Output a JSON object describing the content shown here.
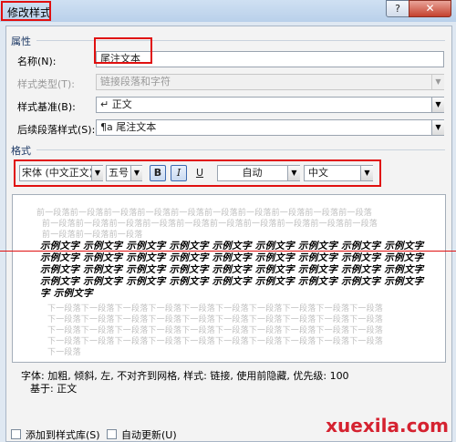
{
  "window": {
    "title": "修改样式",
    "help": "?",
    "close": "✕"
  },
  "properties": {
    "section": "属性",
    "name_label": "名称(N):",
    "name_value": "尾注文本",
    "type_label": "样式类型(T):",
    "type_value": "链接段落和字符",
    "based_label": "样式基准(B):",
    "based_icon": "↵",
    "based_value": "正文",
    "next_label": "后续段落样式(S):",
    "next_icon": "¶a",
    "next_value": "尾注文本"
  },
  "format": {
    "section": "格式",
    "font": "宋体 (中文正文)",
    "size": "五号",
    "bold": "B",
    "italic": "I",
    "underline": "U",
    "color": "自动",
    "language": "中文"
  },
  "preview": {
    "prev_line1": "前一段落前一段落前一段落前一段落前一段落前一段落前一段落前一段落前一段落前一段落",
    "prev_line2": "前一段落前一段落前一段落前一段落前一段落前一段落前一段落前一段落前一段落前一段落",
    "prev_line3": "前一段落前一段落前一段落",
    "sample_line1": "示例文字 示例文字 示例文字 示例文字 示例文字 示例文字 示例文字 示例文字 示例文字",
    "sample_line2": "示例文字 示例文字 示例文字 示例文字 示例文字 示例文字 示例文字 示例文字 示例文字",
    "sample_line3": "示例文字 示例文字 示例文字 示例文字 示例文字 示例文字 示例文字 示例文字 示例文字",
    "sample_line4": "示例文字 示例文字 示例文字 示例文字 示例文字 示例文字 示例文字 示例文字 示例文字",
    "sample_line5": "字 示例文字",
    "next_line1": "下一段落下一段落下一段落下一段落下一段落下一段落下一段落下一段落下一段落下一段落",
    "next_line2": "下一段落下一段落下一段落下一段落下一段落下一段落下一段落下一段落下一段落下一段落",
    "next_line3": "下一段落下一段落下一段落下一段落下一段落下一段落下一段落下一段落下一段落下一段落",
    "next_line4": "下一段落下一段落下一段落下一段落下一段落下一段落下一段落下一段落下一段落下一段落",
    "next_line5": "下一段落"
  },
  "description": {
    "line1": "字体: 加粗, 倾斜, 左, 不对齐到网格, 样式: 链接, 使用前隐藏, 优先级: 100",
    "line2": "基于: 正文"
  },
  "footer": {
    "add_to_gallery": "添加到样式库(S)",
    "auto_update": "自动更新(U)"
  },
  "watermark": "xuexila.com",
  "colors": {
    "annotation": "#e01010",
    "watermark": "#d52230",
    "accent": "#3c6ab0"
  },
  "icons": [
    "align-left-icon",
    "align-center-icon",
    "align-right-icon",
    "justify-icon",
    "single-spacing-icon",
    "one-half-spacing-icon",
    "double-spacing-icon",
    "increase-spacing-icon",
    "decrease-spacing-icon",
    "decrease-indent-icon",
    "increase-indent-icon"
  ]
}
